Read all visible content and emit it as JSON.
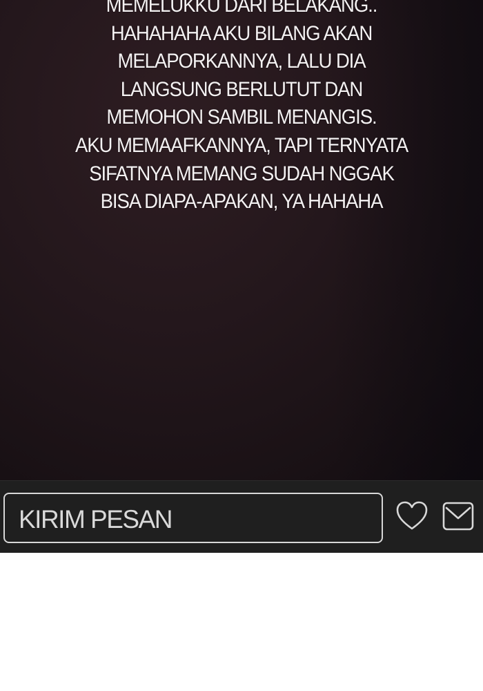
{
  "story": {
    "lines": [
      "MEMELUKKU DARI BELAKANG..",
      "HAHAHAHA AKU BILANG AKAN",
      "MELAPORKANNYA, LALU DIA",
      "LANGSUNG BERLUTUT DAN",
      "MEMOHON SAMBIL MENANGIS.",
      "AKU MEMAAFKANNYA, TAPI TERNYATA",
      "SIFATNYA MEMANG SUDAH NGGAK",
      "BISA DIAPA-APAKAN, YA HAHAHA"
    ]
  },
  "chat_bar": {
    "input_placeholder": "KIRIM PESAN",
    "icons": [
      "heart-icon",
      "mail-icon"
    ]
  },
  "colors": {
    "panel_background": "#23161b",
    "bar_background": "#1f1f1f",
    "text": "#f4f1f2",
    "outline": "#d8d8d8"
  }
}
